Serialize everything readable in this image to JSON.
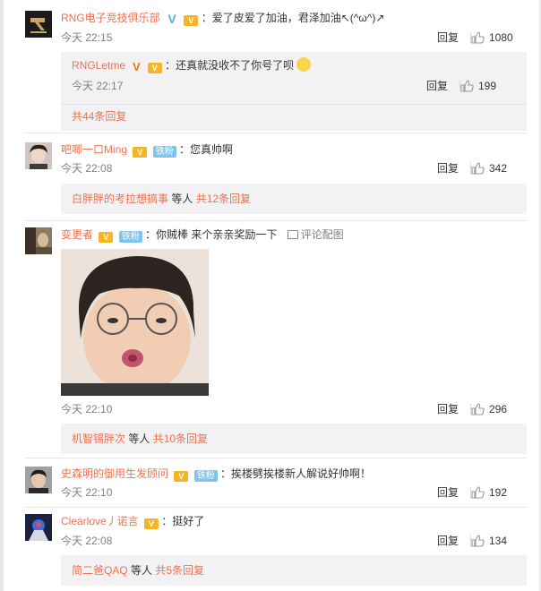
{
  "comments": [
    {
      "user": "RNG电子竞技俱乐部",
      "text": "：爱了皮爱了加油，君泽加油↖(^ω^)↗",
      "time": "今天 22:15",
      "reply_label": "回复",
      "likes": "1080",
      "subreply": {
        "user": "RNGLetme",
        "text": "：还真就没收不了你号了呗",
        "time": "今天 22:17",
        "reply_label": "回复",
        "likes": "199"
      },
      "more": "共44条回复"
    },
    {
      "user": "吧唧一口Ming",
      "iron": "铁粉",
      "text": "：您真帅啊",
      "time": "今天 22:08",
      "reply_label": "回复",
      "likes": "342",
      "more_user": "白胖胖的考拉想搞事",
      "more_mid": " 等人 ",
      "more_count": "共12条回复"
    },
    {
      "user": "变更者",
      "iron": "铁粉",
      "text": "：你贼棒 来个亲亲奖励一下",
      "pic_label": "评论配图",
      "time": "今天 22:10",
      "reply_label": "回复",
      "likes": "296",
      "more_user": "机智锡胖次",
      "more_mid": " 等人 ",
      "more_count": "共10条回复"
    },
    {
      "user": "史森明的御用生发顾问",
      "iron": "铁粉",
      "text": "：挨楼劈挨楼新人解说好帅啊！",
      "time": "今天 22:10",
      "reply_label": "回复",
      "likes": "192"
    },
    {
      "user": "Clearlove丿诺言",
      "text": "：挺好了",
      "time": "今天 22:08",
      "reply_label": "回复",
      "likes": "134",
      "more_user": "简二爸QAQ",
      "more_mid": " 等人 ",
      "more_count": "共5条回复"
    }
  ],
  "icons": {
    "like": "thumbs-up-icon",
    "verified": "verified-v-icon",
    "vip": "vip-crown-icon",
    "picture": "picture-icon"
  },
  "colors": {
    "username": "#eb7350",
    "iron_badge": "#7ec4ef",
    "subreply_bg": "#f2f2f5"
  }
}
